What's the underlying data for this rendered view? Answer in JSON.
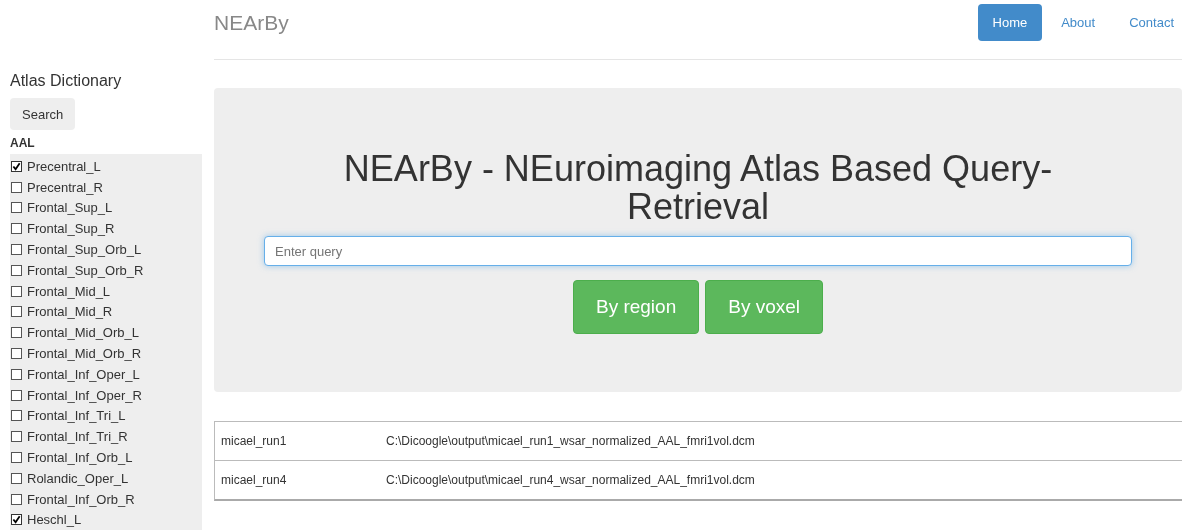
{
  "brand": "NEArBy",
  "nav": [
    {
      "label": "Home",
      "selected": true
    },
    {
      "label": "About",
      "selected": false
    },
    {
      "label": "Contact",
      "selected": false
    }
  ],
  "sidebar": {
    "title": "Atlas Dictionary",
    "search_button": "Search",
    "atlas": "AAL",
    "regions": [
      {
        "label": "Precentral_L",
        "checked": true
      },
      {
        "label": "Precentral_R",
        "checked": false
      },
      {
        "label": "Frontal_Sup_L",
        "checked": false
      },
      {
        "label": "Frontal_Sup_R",
        "checked": false
      },
      {
        "label": "Frontal_Sup_Orb_L",
        "checked": false
      },
      {
        "label": "Frontal_Sup_Orb_R",
        "checked": false
      },
      {
        "label": "Frontal_Mid_L",
        "checked": false
      },
      {
        "label": "Frontal_Mid_R",
        "checked": false
      },
      {
        "label": "Frontal_Mid_Orb_L",
        "checked": false
      },
      {
        "label": "Frontal_Mid_Orb_R",
        "checked": false
      },
      {
        "label": "Frontal_Inf_Oper_L",
        "checked": false
      },
      {
        "label": "Frontal_Inf_Oper_R",
        "checked": false
      },
      {
        "label": "Frontal_Inf_Tri_L",
        "checked": false
      },
      {
        "label": "Frontal_Inf_Tri_R",
        "checked": false
      },
      {
        "label": "Frontal_Inf_Orb_L",
        "checked": false
      },
      {
        "label": "Rolandic_Oper_L",
        "checked": false
      },
      {
        "label": "Frontal_Inf_Orb_R",
        "checked": false
      },
      {
        "label": "Heschl_L",
        "checked": true
      }
    ]
  },
  "hero": {
    "title": "NEArBy - NEuroimaging Atlas Based Query-Retrieval",
    "query": {
      "placeholder": "Enter query"
    },
    "buttons": [
      "By region",
      "By voxel"
    ]
  },
  "results": [
    {
      "name": "micael_run1",
      "path": "C:\\Dicoogle\\output\\micael_run1_wsar_normalized_AAL_fmri1vol.dcm"
    },
    {
      "name": "micael_run4",
      "path": "C:\\Dicoogle\\output\\micael_run4_wsar_normalized_AAL_fmri1vol.dcm"
    }
  ]
}
